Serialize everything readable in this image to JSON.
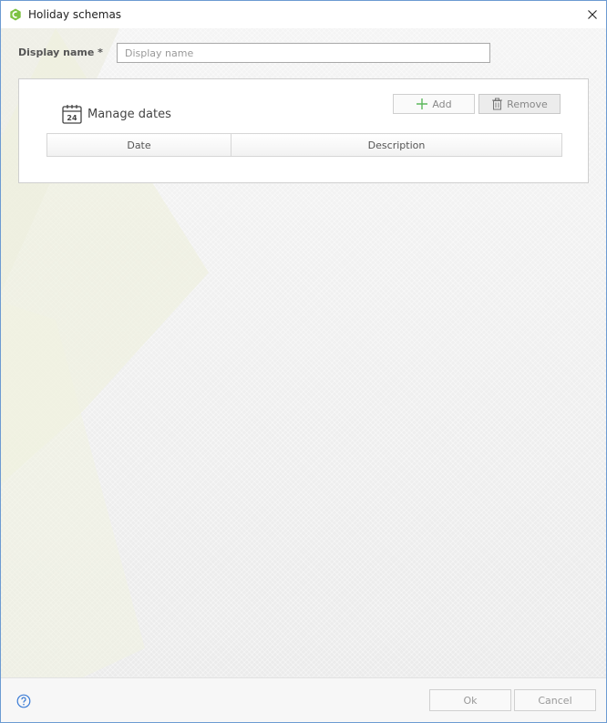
{
  "window": {
    "title": "Holiday schemas"
  },
  "form": {
    "display_name_label": "Display name *",
    "display_name_value": "",
    "display_name_placeholder": "Display name"
  },
  "panel": {
    "title": "Manage dates",
    "calendar_day": "24",
    "toolbar": {
      "add_label": "Add",
      "remove_label": "Remove"
    },
    "table": {
      "columns": [
        "Date",
        "Description"
      ],
      "rows": []
    }
  },
  "footer": {
    "ok_label": "Ok",
    "cancel_label": "Cancel"
  },
  "colors": {
    "accent_green": "#7dc243",
    "window_border": "#6c9bd2"
  }
}
